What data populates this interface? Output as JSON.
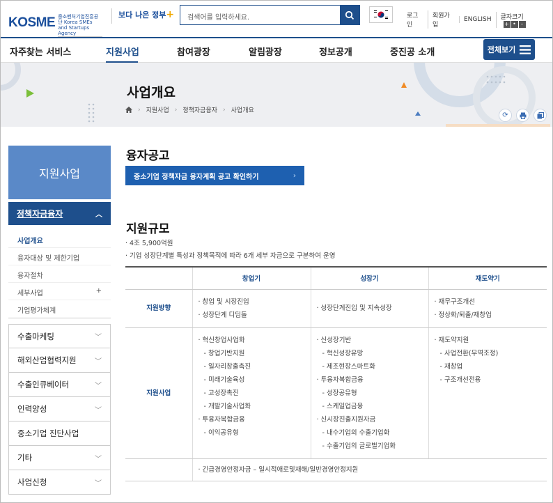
{
  "header": {
    "logo_text": "KOSME",
    "logo_sub": "중소벤처기업진흥공단 Korea SMEs and Startups Agency",
    "gov_logo": "보다 나은 정부",
    "search_placeholder": "검색어를 입력하세요.",
    "util": [
      "로그인",
      "회원가입",
      "ENGLISH",
      "글자크기"
    ],
    "font_size_buttons": [
      "+",
      "•",
      "-"
    ]
  },
  "nav": {
    "items": [
      "자주찾는 서비스",
      "지원사업",
      "참여광장",
      "알림광장",
      "정보공개",
      "중진공 소개"
    ],
    "active": "지원사업",
    "all_button": "전체보기"
  },
  "hero": {
    "title": "사업개요",
    "breadcrumb": [
      "지원사업",
      "정책자금융자",
      "사업개요"
    ]
  },
  "sidebar": {
    "title": "지원사업",
    "current": "정책자금융자",
    "sub_items": [
      {
        "label": "사업개요",
        "active": true,
        "plus": ""
      },
      {
        "label": "융자대상 및 제한기업",
        "plus": ""
      },
      {
        "label": "융자절차",
        "plus": ""
      },
      {
        "label": "세부사업",
        "plus": "+"
      },
      {
        "label": "기업평가체계",
        "plus": ""
      }
    ],
    "menu": [
      {
        "label": "수출마케팅",
        "chevron": true
      },
      {
        "label": "해외산업협력지원",
        "chevron": true
      },
      {
        "label": "수출인큐베이터",
        "chevron": true
      },
      {
        "label": "인력양성",
        "chevron": true
      },
      {
        "label": "중소기업 진단사업",
        "chevron": false
      },
      {
        "label": "기타",
        "chevron": true
      },
      {
        "label": "사업신청",
        "chevron": true
      }
    ]
  },
  "content": {
    "section1_title": "융자공고",
    "cta": "중소기업 정책자금 융자계획 공고 확인하기",
    "section2_title": "지원규모",
    "bullets": [
      "4조 5,900억원",
      "기업 성장단계별 특성과 정책목적에 따라 6개 세부 자금으로 구분하여 운영"
    ],
    "table": {
      "headers": [
        "",
        "창업기",
        "성장기",
        "재도약기"
      ],
      "row1": {
        "head": "지원방향",
        "c1": [
          "창업 및 시장진입",
          "성장단계 디딤돌"
        ],
        "c2": [
          "성장단계진입 및 지속성장"
        ],
        "c3": [
          "재무구조개선",
          "정상화/퇴출/재창업"
        ]
      },
      "row2": {
        "head": "지원사업",
        "c1": [
          {
            "t": "혁신창업사업화",
            "l": 1
          },
          {
            "t": "창업기반지원",
            "l": 2
          },
          {
            "t": "일자리창출촉진",
            "l": 2
          },
          {
            "t": "미래기술육성",
            "l": 2
          },
          {
            "t": "고성장촉진",
            "l": 2
          },
          {
            "t": "개발기술사업화",
            "l": 2
          },
          {
            "t": "투융자복합금융",
            "l": 1
          },
          {
            "t": "이익공유형",
            "l": 2
          }
        ],
        "c2": [
          {
            "t": "신성장기반",
            "l": 1
          },
          {
            "t": "혁신성장유망",
            "l": 2
          },
          {
            "t": "제조현장스마트화",
            "l": 2
          },
          {
            "t": "투융자복합금융",
            "l": 1
          },
          {
            "t": "성장공유형",
            "l": 2
          },
          {
            "t": "스케일업금융",
            "l": 2
          },
          {
            "t": "신시장진출지원자금",
            "l": 1
          },
          {
            "t": "내수기업의 수출기업화",
            "l": 2
          },
          {
            "t": "수출기업의 글로벌기업화",
            "l": 2
          }
        ],
        "c3": [
          {
            "t": "재도약지원",
            "l": 1
          },
          {
            "t": "사업전환(무역조정)",
            "l": 2
          },
          {
            "t": "재창업",
            "l": 2
          },
          {
            "t": "구조개선전용",
            "l": 2
          }
        ]
      },
      "row3": "긴급경영안정자금 – 일시적애로및재해/일반경영안정지원"
    }
  }
}
